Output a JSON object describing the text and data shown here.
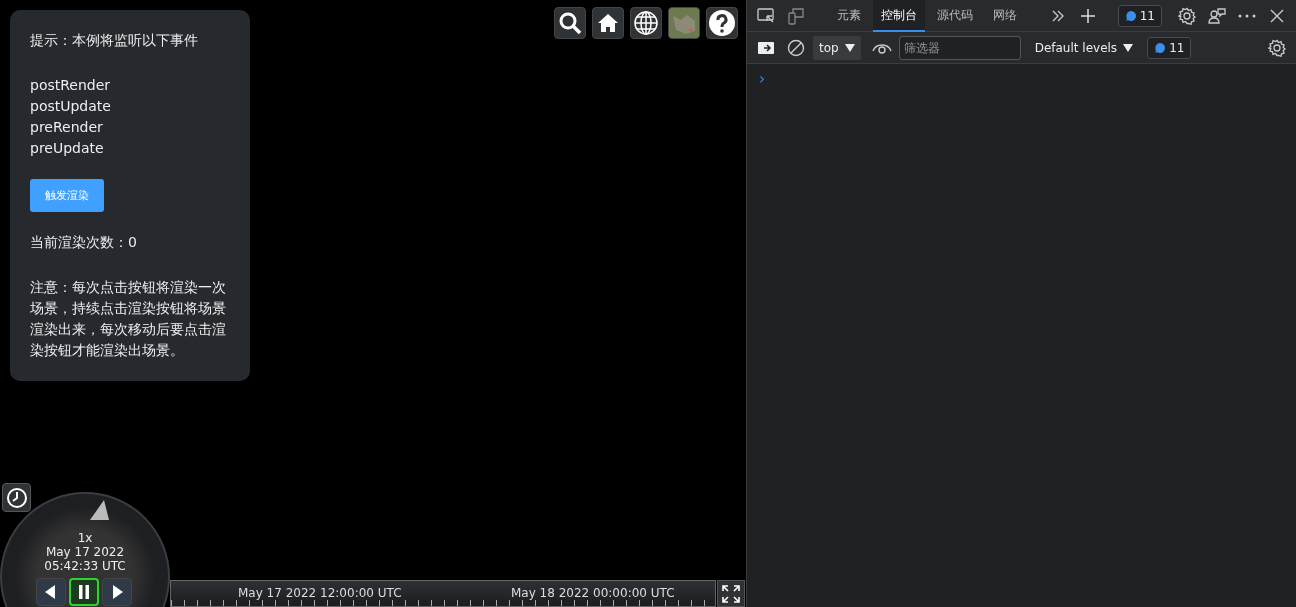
{
  "info_panel": {
    "hint": "提示：本例将监听以下事件",
    "events": [
      "postRender",
      "postUpdate",
      "preRender",
      "preUpdate"
    ],
    "button": "触发渲染",
    "count_label": "当前渲染次数：0",
    "note": "注意：每次点击按钮将渲染一次场景，持续点击渲染按钮将场景渲染出来，每次移动后要点击渲染按钮才能渲染出场景。"
  },
  "animation": {
    "speed": "1x",
    "date": "May 17 2022",
    "time": "05:42:33 UTC",
    "controls": [
      {
        "kind": "reverse",
        "selected": false
      },
      {
        "kind": "pause",
        "selected": true
      },
      {
        "kind": "play",
        "selected": false
      }
    ]
  },
  "timeline": {
    "labels": [
      "May 17 2022 12:00:00 UTC",
      "May 18 2022 00:00:00 UTC"
    ]
  },
  "devtools": {
    "tabs": [
      {
        "label": "元素",
        "selected": false
      },
      {
        "label": "控制台",
        "selected": true
      },
      {
        "label": "源代码",
        "selected": false
      },
      {
        "label": "网络",
        "selected": false
      }
    ],
    "issues_count": "11",
    "context": "top",
    "filter": {
      "placeholder": "筛选器"
    },
    "levels": "Default levels",
    "console_issues": "11",
    "prompt": "›"
  }
}
